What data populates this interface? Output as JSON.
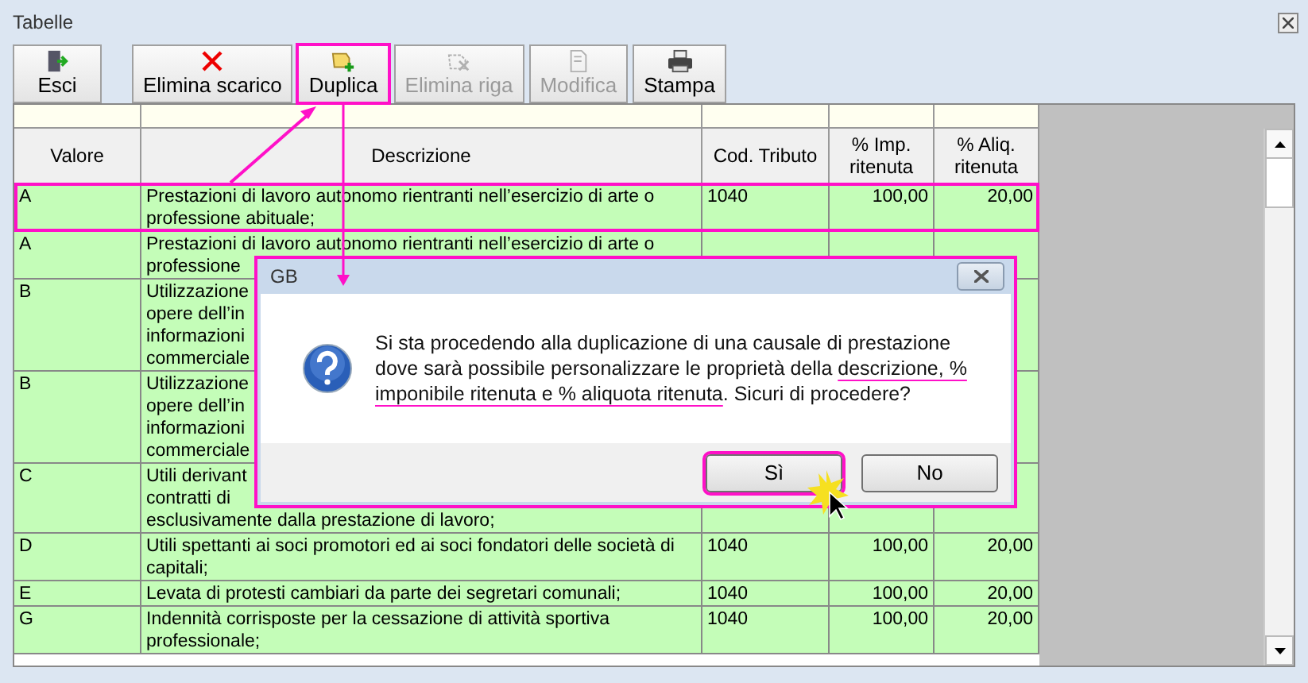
{
  "window": {
    "title": "Tabelle"
  },
  "toolbar": [
    {
      "label": "Esci",
      "kind": "exit",
      "disabled": false,
      "highlighted": false
    },
    {
      "label": "Elimina scarico",
      "kind": "delete",
      "disabled": false,
      "highlighted": false
    },
    {
      "label": "Duplica",
      "kind": "duplicate",
      "disabled": false,
      "highlighted": true
    },
    {
      "label": "Elimina riga",
      "kind": "remove",
      "disabled": true,
      "highlighted": false
    },
    {
      "label": "Modifica",
      "kind": "edit",
      "disabled": true,
      "highlighted": false
    },
    {
      "label": "Stampa",
      "kind": "print",
      "disabled": false,
      "highlighted": false
    }
  ],
  "table": {
    "columns": [
      "Valore",
      "Descrizione",
      "Cod. Tributo",
      "% Imp.\nritenuta",
      "% Aliq.\nritenuta"
    ],
    "rows": [
      {
        "valore": "A",
        "descrizione": "Prestazioni di lavoro autonomo rientranti nell’esercizio di arte o professione abituale;",
        "cod": "1040",
        "imp": "100,00",
        "aliq": "20,00",
        "highlighted": true
      },
      {
        "valore": "A",
        "descrizione": "Prestazioni di lavoro autonomo rientranti nell’esercizio di arte o\nprofessione",
        "highlighted": false
      },
      {
        "valore": "B",
        "descrizione": "Utilizzazione\nopere dell’in\ninformazioni\ncommerciale",
        "highlighted": false
      },
      {
        "valore": "B",
        "descrizione": "Utilizzazione\nopere dell’in\ninformazioni\ncommerciale",
        "highlighted": false
      },
      {
        "valore": "C",
        "descrizione": "Utili derivant\ncontratti di\nesclusivamente dalla prestazione di lavoro;",
        "highlighted": false
      },
      {
        "valore": "D",
        "descrizione": "Utili spettanti ai soci promotori ed ai soci fondatori delle società di capitali;",
        "cod": "1040",
        "imp": "100,00",
        "aliq": "20,00",
        "highlighted": false
      },
      {
        "valore": "E",
        "descrizione": "Levata di protesti cambiari da parte dei segretari comunali;",
        "cod": "1040",
        "imp": "100,00",
        "aliq": "20,00",
        "highlighted": false
      },
      {
        "valore": "G",
        "descrizione": "Indennità corrisposte per la cessazione di attività sportiva professionale;",
        "cod": "1040",
        "imp": "100,00",
        "aliq": "20,00",
        "highlighted": false
      }
    ]
  },
  "dialog": {
    "title": "GB",
    "message": [
      {
        "text": "Si sta procedendo alla duplicazione di una causale di prestazione dove sarà possibile personalizzare le proprietà della ",
        "underlined": false
      },
      {
        "text": "descrizione, % imponibile ritenuta e % aliquota ritenuta",
        "underlined": true
      },
      {
        "text": ". Sicuri di procedere?",
        "underlined": false
      }
    ],
    "buttons": [
      {
        "label": "Sì",
        "highlighted": true
      },
      {
        "label": "No",
        "highlighted": false
      }
    ]
  }
}
